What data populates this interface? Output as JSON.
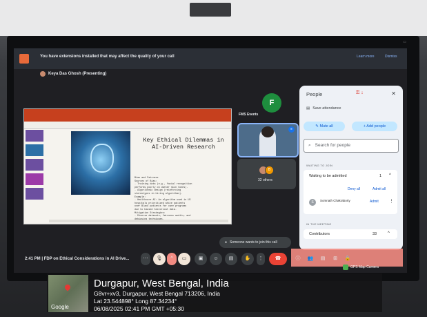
{
  "banner": {
    "text": "You have extensions installed that may affect the quality of your call",
    "learn_more": "Learn more",
    "dismiss": "Dismiss"
  },
  "presenter": "Keya Das Ghosh (Presenting)",
  "slide": {
    "title": "Key Ethical Dilemmas in AI-Driven Research",
    "body_lines": [
      "Bias and Fairness",
      "Sources of Bias:",
      "- Training data (e.g., facial recognition",
      "  performs poorly on darker skin tones).",
      "- Algorithmic design (reinforcing",
      "  stereotypes in hiring algorithms).",
      "Example:",
      "- Healthcare AI: An algorithm used in US",
      "  hospitals prioritized white patients",
      "  over Black patients for care programs",
      "  due to biased historical data.",
      "Mitigation Strategies:",
      "- Diverse datasets, fairness audits, and",
      "  debiasing techniques."
    ]
  },
  "tiles": {
    "host_initial": "F",
    "host_label": "FMS Events",
    "others_count_label": "32 others",
    "others_avatar_letter": "B"
  },
  "people_panel": {
    "title": "People",
    "close": "✕",
    "save_attendance": "Save attendance",
    "mute_all": "Mute all",
    "add_people": "Add people",
    "search_placeholder": "Search for people",
    "waiting_header": "WAITING TO JOIN",
    "waiting_title": "Waiting to be admitted",
    "waiting_count": "1",
    "deny_all": "Deny all",
    "admit_all": "Admit all",
    "person_name": "Somnath Chakraborty",
    "person_initial": "S",
    "person_admit": "Admit",
    "in_meeting_header": "IN THE MEETING",
    "contributors_label": "Contributors",
    "contributors_count": "33"
  },
  "toast": "Someone wants to join this call",
  "bottom": {
    "time_meeting": "2:41 PM | FDP on Ethical Considerations in AI Drive..."
  },
  "overlay": {
    "city": "Durgapur, West Bengal, India",
    "address": "G8vr+xv3, Durgapur, West Bengal 713206, India",
    "coords": "Lat 23.544898° Long 87.34234°",
    "datetime": "06/08/2025 02:41 PM GMT +05:30",
    "map_brand": "Google",
    "gps_label": "GPS Map Camera"
  },
  "colors": {
    "accent_blue": "#8ab4f8",
    "end_call_red": "#ea4335",
    "ppt_red": "#c6401e"
  }
}
